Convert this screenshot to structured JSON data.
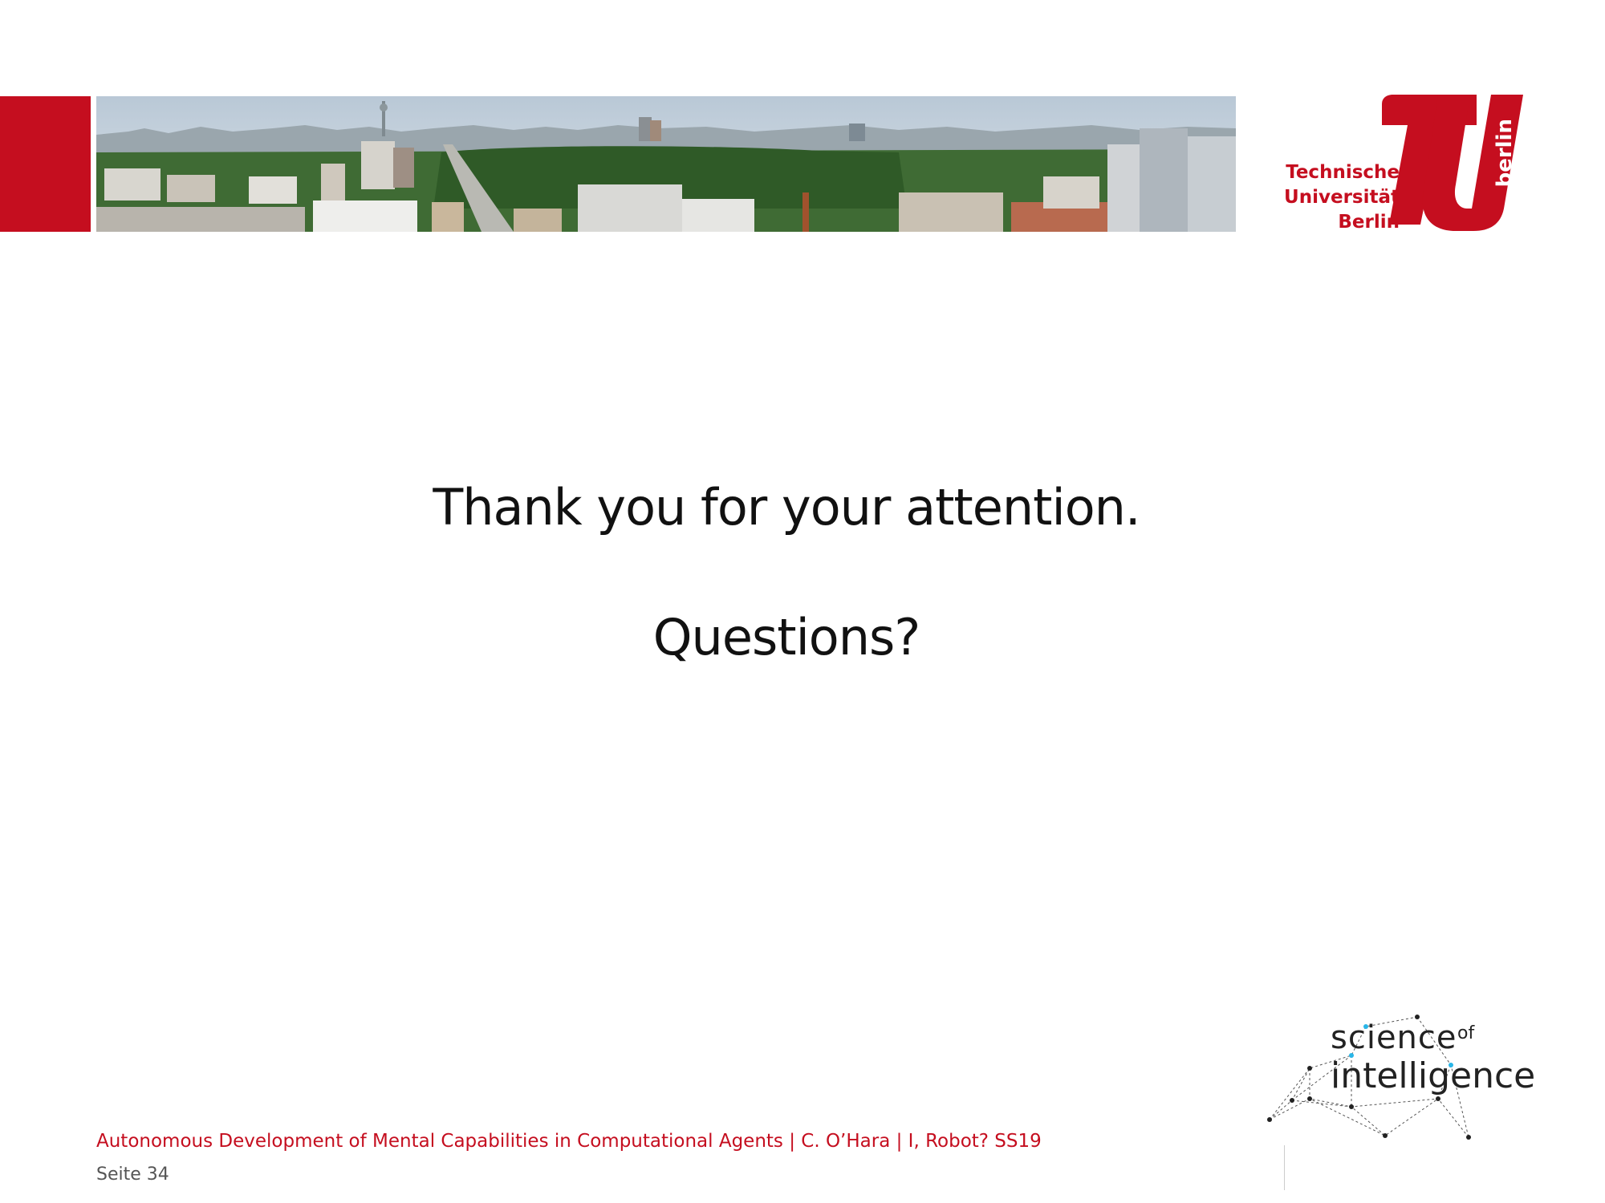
{
  "brand": {
    "red": "#c50e1f",
    "text": "#111111",
    "muted": "#555555"
  },
  "university": {
    "line1": "Technische",
    "line2": "Universität",
    "line3": "Berlin",
    "badge": "berlin"
  },
  "slide": {
    "line1": "Thank you for your attention.",
    "line2": "Questions?"
  },
  "soi_logo": {
    "science": "science",
    "of": "of",
    "intelligence": "intelligence",
    "icon": "network-graph-icon"
  },
  "footer": {
    "title": "Autonomous Development of Mental Capabilities in Computational Agents | C. O’Hara | I, Robot? SS19",
    "page": "Seite 34"
  }
}
